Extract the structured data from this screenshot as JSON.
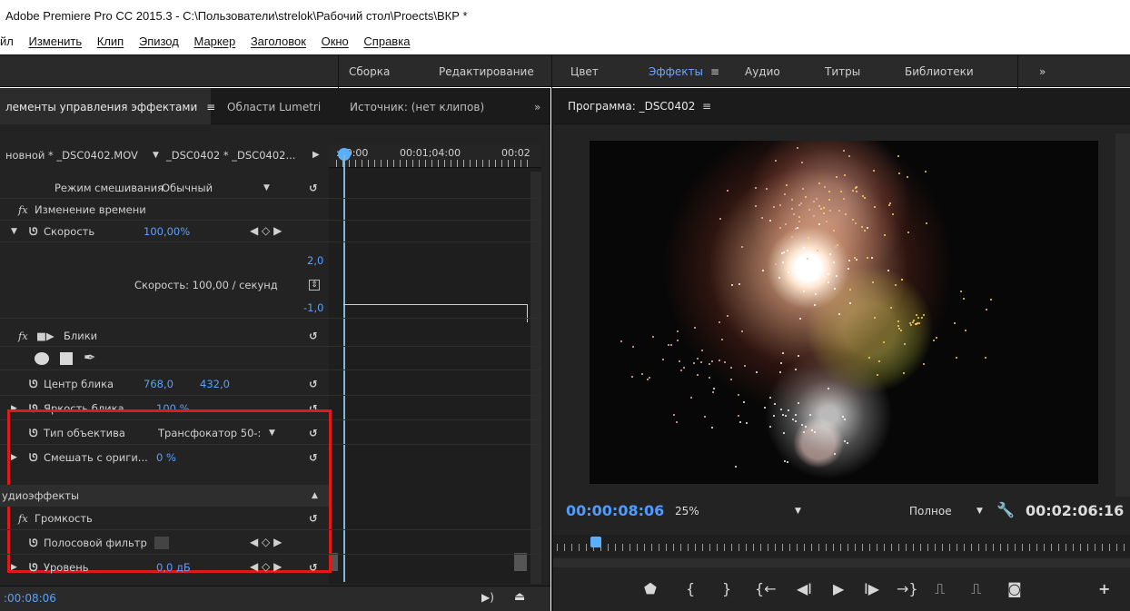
{
  "window": {
    "title": "Adobe Premiere Pro CC 2015.3 - C:\\Пользователи\\strelok\\Рабочий стол\\Proects\\ВКР *"
  },
  "menu": [
    "йл",
    "Изменить",
    "Клип",
    "Эпизод",
    "Маркер",
    "Заголовок",
    "Окно",
    "Справка"
  ],
  "workspaces": {
    "items": [
      "Сборка",
      "Редактирование",
      "Цвет",
      "Эффекты",
      "Аудио",
      "Титры",
      "Библиотеки"
    ],
    "active": "Эффекты",
    "menu_glyph": "≡",
    "overflow": "»"
  },
  "left_panel": {
    "tabs": [
      "лементы управления эффектами",
      "Области Lumetri",
      "Источник: (нет клипов)"
    ],
    "tab_menu_glyph": "≡",
    "overflow": "»",
    "clip_selector": {
      "master": "новной * _DSC0402.MOV",
      "sequence": "_DSC0402 * _DSC0402..."
    },
    "ruler": {
      "t0": ":00:00",
      "t1": "00:01;04:00",
      "t2": "00:02"
    },
    "blend_mode": {
      "label": "Режим смешивания",
      "value": "Обычный"
    },
    "time_remap": {
      "label": "Изменение времени"
    },
    "speed": {
      "label": "Скорость",
      "value": "100,00%"
    },
    "speed_graph": {
      "max": "2,0",
      "min": "-1,0",
      "readout": "Скорость: 100,00 / секунд"
    },
    "lens_flare": {
      "title": "Блики",
      "center": {
        "label": "Центр блика",
        "x": "768,0",
        "y": "432,0"
      },
      "brightness": {
        "label": "Яркость блика",
        "value": "100 %"
      },
      "lens_type": {
        "label": "Тип объектива",
        "value": "Трансфокатор 50-:"
      },
      "blend": {
        "label": "Смешать с ориги...",
        "value": "0 %"
      }
    },
    "audio_effects": {
      "header": "удиоэффекты",
      "volume": {
        "label": "Громкость"
      },
      "bypass": {
        "label": "Полосовой фильтр"
      },
      "level": {
        "label": "Уровень",
        "value": "0,0 дБ"
      }
    },
    "timecode": ":00:08:06"
  },
  "program_monitor": {
    "title": "Программа: _DSC0402",
    "menu_glyph": "≡",
    "timecode": "00:00:08:06",
    "zoom": "25%",
    "quality": "Полное",
    "duration": "00:02:06:16",
    "playhead_fraction": 0.06
  },
  "colors": {
    "accent_blue": "#5aa0ff",
    "timecode_blue": "#4f9bff",
    "highlight_box": "#e01a1a",
    "panel_bg": "#232323"
  },
  "icons": [
    "fx-icon",
    "stopwatch-icon",
    "reset-icon",
    "keyframe-nav-icon",
    "ellipse-mask-icon",
    "rect-mask-icon",
    "pen-icon",
    "wrench-icon",
    "marker-icon",
    "in-point-icon",
    "out-point-icon",
    "go-to-in-icon",
    "step-back-icon",
    "play-icon",
    "step-forward-icon",
    "go-to-out-icon",
    "lift-icon",
    "extract-icon",
    "camera-icon",
    "plus-icon"
  ]
}
